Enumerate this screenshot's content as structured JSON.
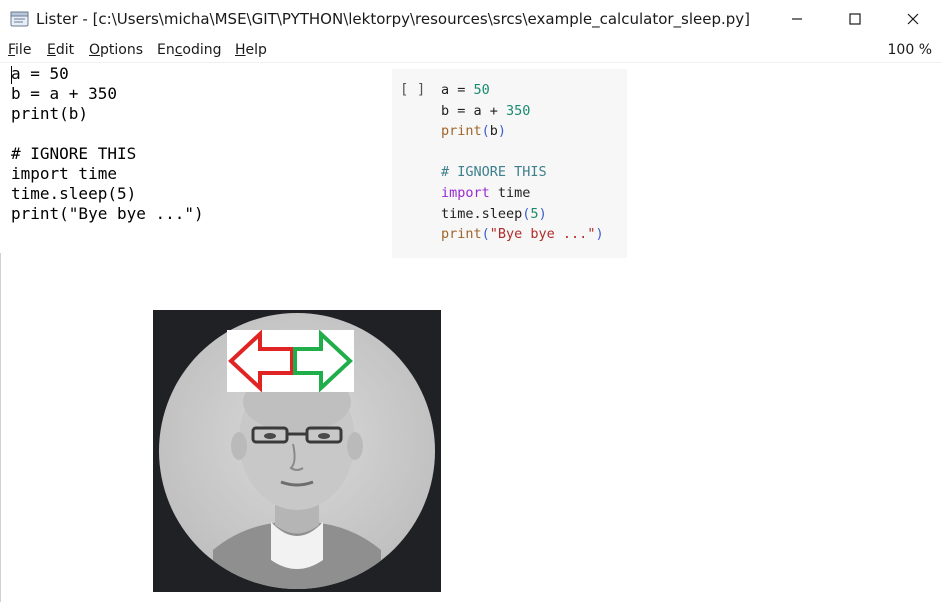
{
  "window": {
    "title": "Lister - [c:\\Users\\micha\\MSE\\GIT\\PYTHON\\lektorpy\\resources\\srcs\\example_calculator_sleep.py]",
    "controls": [
      "minimize",
      "maximize",
      "close"
    ]
  },
  "menu": {
    "items": [
      {
        "accel": "F",
        "rest": "ile"
      },
      {
        "accel": "E",
        "rest": "dit"
      },
      {
        "accel": "O",
        "rest": "ptions"
      },
      {
        "pre": "En",
        "accel": "c",
        "rest": "oding"
      },
      {
        "accel": "H",
        "rest": "elp"
      }
    ],
    "zoom": "100 %"
  },
  "editor": {
    "lines": [
      "a = 50",
      "b = a + 350",
      "print(b)",
      "",
      "# IGNORE THIS",
      "import time",
      "time.sleep(5)",
      "print(\"Bye bye ...\")"
    ]
  },
  "cell": {
    "prompt": "[ ]",
    "tokens": [
      [
        [
          "a = ",
          ""
        ],
        [
          "50",
          "green"
        ]
      ],
      [
        [
          "b = a + ",
          ""
        ],
        [
          "350",
          "green"
        ]
      ],
      [
        [
          "print",
          "func"
        ],
        [
          "(",
          "paren"
        ],
        [
          "b",
          ""
        ],
        [
          ")",
          "paren"
        ]
      ],
      [],
      [
        [
          "# IGNORE THIS",
          "comment"
        ]
      ],
      [
        [
          "import",
          "import"
        ],
        [
          " time",
          ""
        ]
      ],
      [
        [
          "time.sleep",
          ""
        ],
        [
          "(",
          "paren"
        ],
        [
          "5",
          "green"
        ],
        [
          ")",
          "paren"
        ]
      ],
      [
        [
          "print",
          "func"
        ],
        [
          "(",
          "paren"
        ],
        [
          "\"Bye bye ...\"",
          "str"
        ],
        [
          ")",
          "paren"
        ]
      ]
    ]
  },
  "colors": {
    "cell_bg": "#f7f7f7",
    "photo_bg": "#1f2124",
    "arrow_left": "#e02424",
    "arrow_right": "#1fae4a"
  },
  "icons": {
    "app": "notepad-icon",
    "minimize": "minimize-icon",
    "maximize": "maximize-icon",
    "close": "close-icon",
    "arrow_left": "arrow-left-icon",
    "arrow_right": "arrow-right-icon"
  }
}
